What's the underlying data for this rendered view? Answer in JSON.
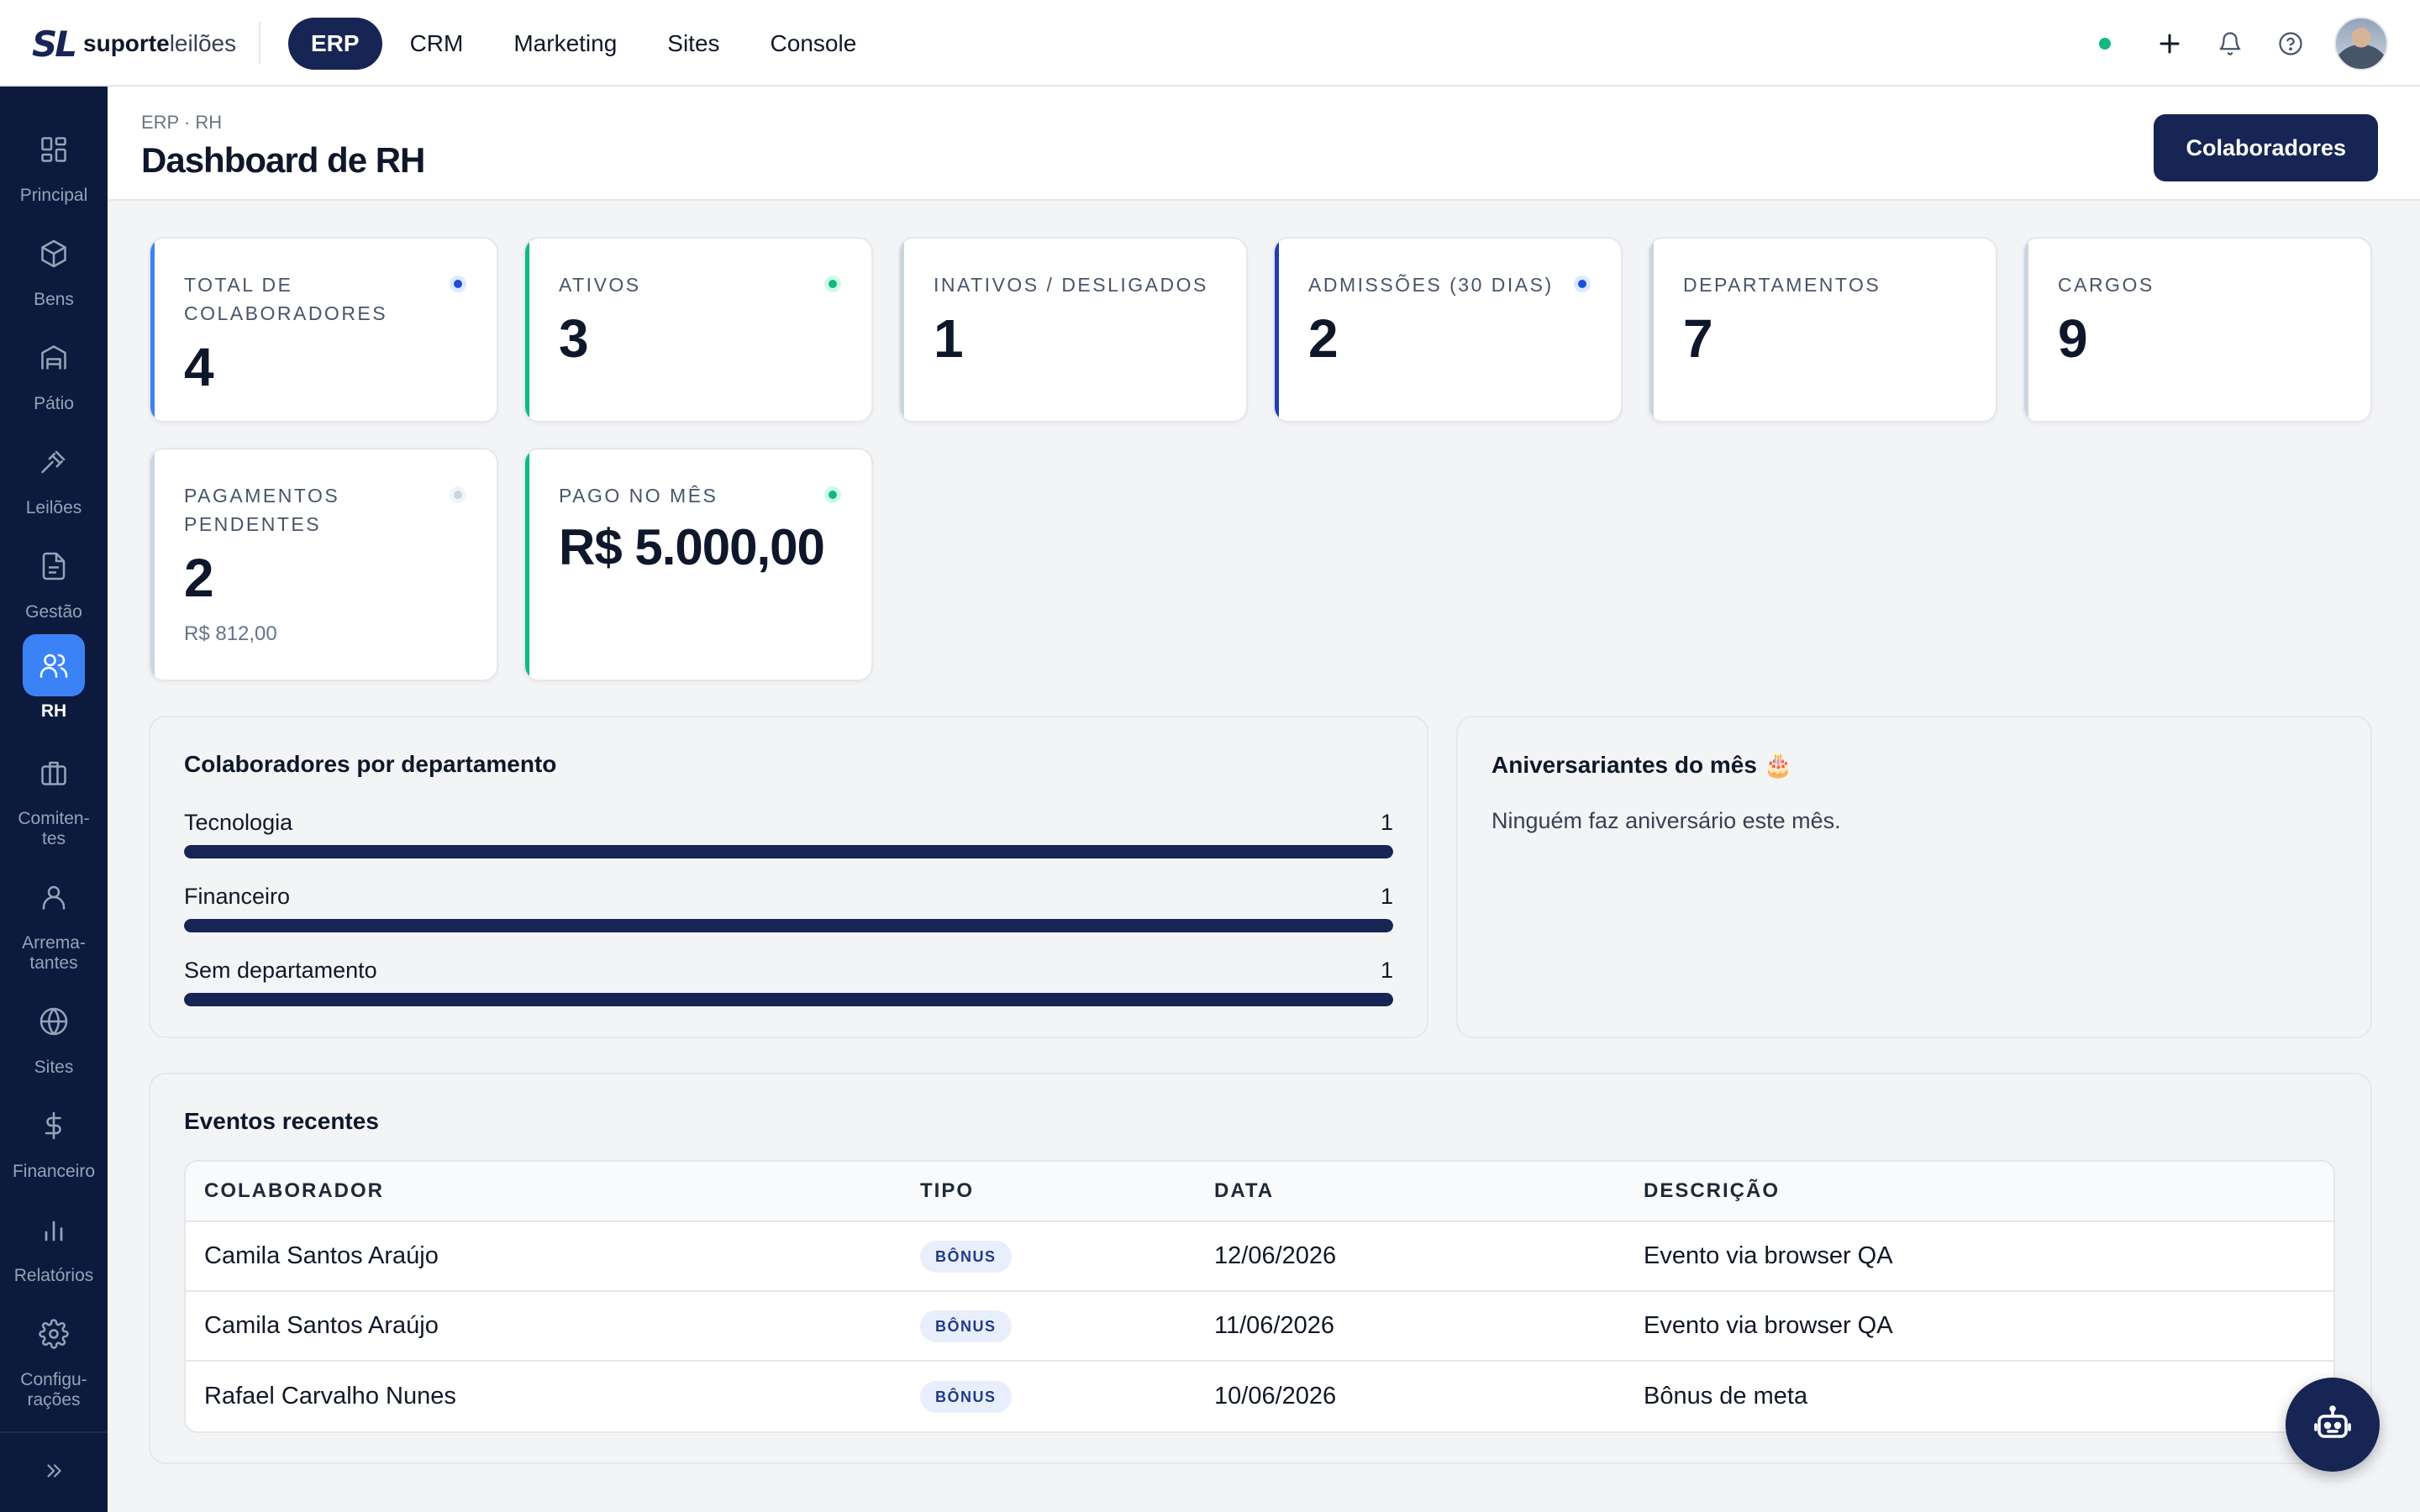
{
  "brand": {
    "mark": "SL",
    "name_bold": "suporte",
    "name_light": "leilões"
  },
  "topnav": [
    {
      "label": "ERP",
      "active": true
    },
    {
      "label": "CRM"
    },
    {
      "label": "Marketing"
    },
    {
      "label": "Sites"
    },
    {
      "label": "Console"
    }
  ],
  "sidebar": [
    {
      "label": "Principal",
      "icon": "grid-icon"
    },
    {
      "label": "Bens",
      "icon": "box-icon"
    },
    {
      "label": "Pátio",
      "icon": "warehouse-icon"
    },
    {
      "label": "Leilões",
      "icon": "gavel-icon"
    },
    {
      "label": "Gestão",
      "icon": "document-icon"
    },
    {
      "label": "RH",
      "icon": "users-icon",
      "active": true
    },
    {
      "label": "Comiten-\ntes",
      "icon": "briefcase-icon"
    },
    {
      "label": "Arrema-\ntantes",
      "icon": "user-icon"
    },
    {
      "label": "Sites",
      "icon": "globe-icon"
    },
    {
      "label": "Financeiro",
      "icon": "dollar-icon"
    },
    {
      "label": "Relatórios",
      "icon": "bar-chart-icon"
    },
    {
      "label": "Configu-\nrações",
      "icon": "gear-icon"
    }
  ],
  "header": {
    "breadcrumb": "ERP · RH",
    "title": "Dashboard de RH",
    "action_label": "Colaboradores"
  },
  "stats": [
    {
      "label": "TOTAL DE COLABORADORES",
      "value": "4",
      "accent": "#3b82f6",
      "dot": "#1d4ed8"
    },
    {
      "label": "ATIVOS",
      "value": "3",
      "accent": "#10b981",
      "dot": "#10b981"
    },
    {
      "label": "INATIVOS / DESLIGADOS",
      "value": "1",
      "accent": "#cbd5e1"
    },
    {
      "label": "ADMISSÕES (30 DIAS)",
      "value": "2",
      "accent": "#1e40af",
      "dot": "#1d4ed8"
    },
    {
      "label": "DEPARTAMENTOS",
      "value": "7",
      "accent": "#cbd5e1"
    },
    {
      "label": "CARGOS",
      "value": "9",
      "accent": "#cbd5e1"
    },
    {
      "label": "PAGAMENTOS PENDENTES",
      "value": "2",
      "sub": "R$ 812,00",
      "accent": "#cbd5e1",
      "dot": "#cbd5e1"
    },
    {
      "label": "PAGO NO MÊS",
      "value": "R$ 5.000,00",
      "accent": "#10b981",
      "dot": "#10b981"
    }
  ],
  "departments": {
    "title": "Colaboradores por departamento",
    "items": [
      {
        "name": "Tecnologia",
        "count": "1",
        "fraction": 1.0
      },
      {
        "name": "Financeiro",
        "count": "1",
        "fraction": 1.0
      },
      {
        "name": "Sem departamento",
        "count": "1",
        "fraction": 1.0
      }
    ]
  },
  "birthdays": {
    "title": "Aniversariantes do mês 🎂",
    "empty": "Ninguém faz aniversário este mês."
  },
  "events": {
    "title": "Eventos recentes",
    "columns": [
      "COLABORADOR",
      "TIPO",
      "DATA",
      "DESCRIÇÃO"
    ],
    "rows": [
      {
        "colaborador": "Camila Santos Araújo",
        "tipo": "BÔNUS",
        "data": "12/06/2026",
        "descricao": "Evento via browser QA"
      },
      {
        "colaborador": "Camila Santos Araújo",
        "tipo": "BÔNUS",
        "data": "11/06/2026",
        "descricao": "Evento via browser QA"
      },
      {
        "colaborador": "Rafael Carvalho Nunes",
        "tipo": "BÔNUS",
        "data": "10/06/2026",
        "descricao": "Bônus de meta"
      }
    ]
  },
  "colors": {
    "navy": "#172554",
    "sidebar": "#0c1a3d",
    "active_blue": "#3b82f6",
    "green": "#10b981"
  }
}
